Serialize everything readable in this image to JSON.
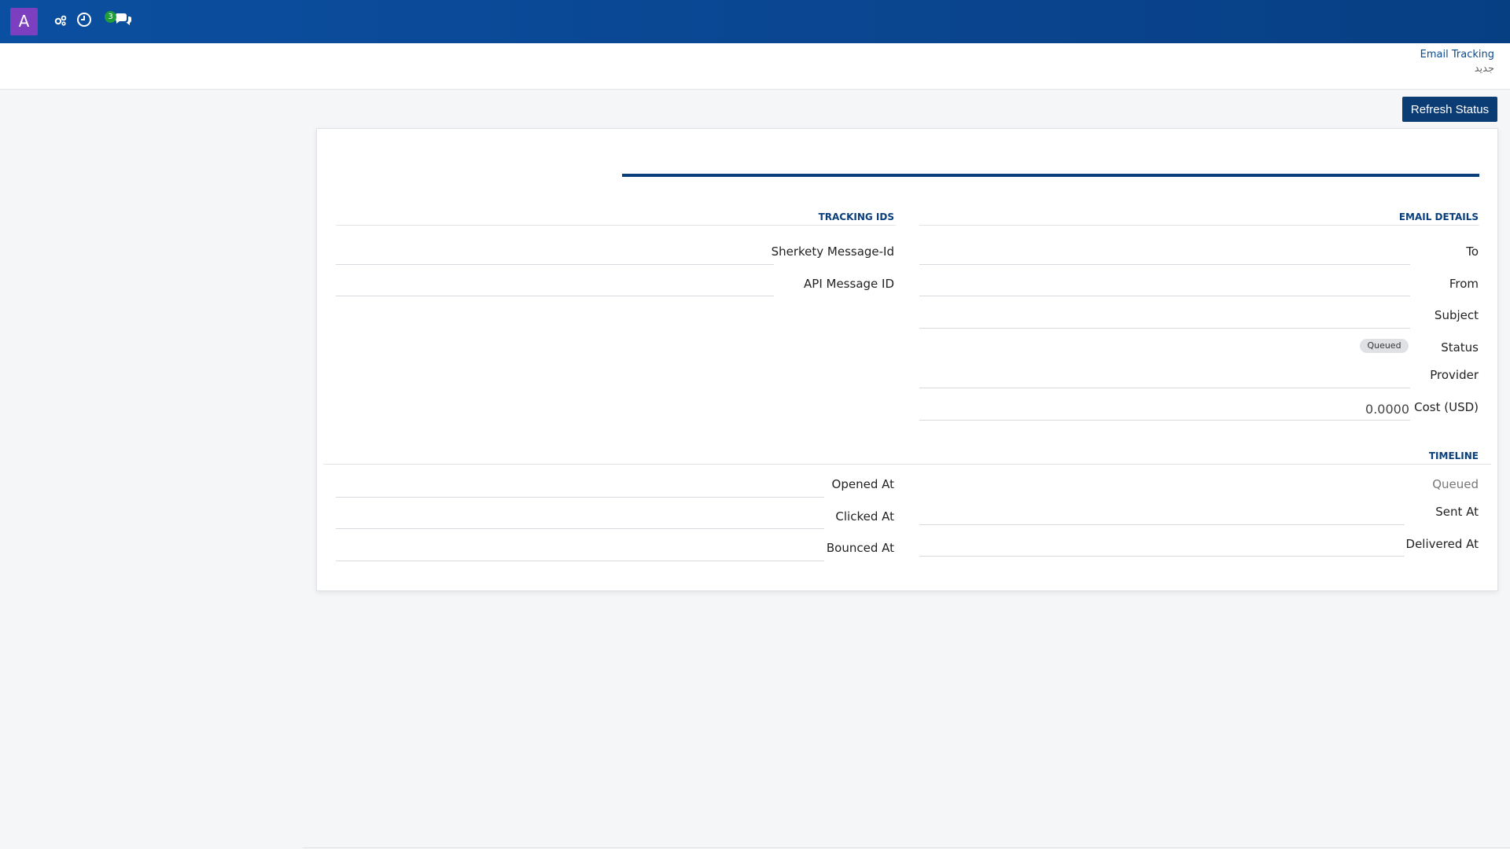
{
  "topbar": {
    "avatar_letter": "A",
    "icons": [
      "settings-gear-icon",
      "clock-icon",
      "chat-icon"
    ],
    "chat_badge": "3",
    "colors": {
      "bar": "#0b4fa0",
      "avatar": "#7b3fbf",
      "badge": "#1f9d3a"
    }
  },
  "breadcrumb": {
    "title": "Email Tracking",
    "subtitle": "جديد"
  },
  "actions": {
    "refresh_label": "Refresh Status"
  },
  "sections": {
    "email_details": "EMAIL DETAILS",
    "tracking_ids": "TRACKING IDS",
    "timeline": "TIMELINE"
  },
  "email_details": {
    "to_label": "To",
    "from_label": "From",
    "subject_label": "Subject",
    "status_label": "Status",
    "status_value": "Queued",
    "provider_label": "Provider",
    "cost_label": "Cost (USD)",
    "cost_value": "0.0000"
  },
  "tracking_ids": {
    "message_id_label": "Sherkety Message-Id",
    "api_id_label": "API Message ID"
  },
  "timeline": {
    "status_value": "Queued",
    "sent_label": "Sent At",
    "delivered_label": "Delivered At",
    "opened_label": "Opened At",
    "clicked_label": "Clicked At",
    "bounced_label": "Bounced At"
  }
}
